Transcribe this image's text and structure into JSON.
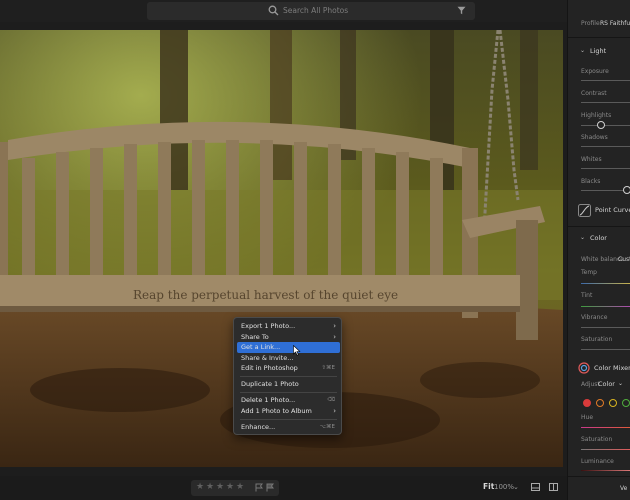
{
  "search": {
    "placeholder": "Search All Photos"
  },
  "photo": {
    "engraving": "Reap the perpetual harvest of the quiet eye"
  },
  "context_menu": {
    "items": [
      {
        "label": "Export 1 Photo...",
        "arrow": "›"
      },
      {
        "label": "Share To",
        "arrow": "›"
      },
      {
        "label": "Get a Link...",
        "highlighted": true
      },
      {
        "label": "Share & Invite..."
      },
      {
        "label": "Edit in Photoshop",
        "shortcut": "⇧⌘E"
      },
      {
        "label": "Duplicate 1 Photo"
      },
      {
        "label": "Delete 1 Photo...",
        "shortcut": "⌫"
      },
      {
        "label": "Add 1 Photo to Album",
        "arrow": "›"
      },
      {
        "label": "Enhance...",
        "shortcut": "⌥⌘E"
      }
    ]
  },
  "bottom_bar": {
    "stars": [
      "★",
      "★",
      "★",
      "★",
      "★"
    ],
    "fit_label": "Fit",
    "zoom_label": "100%",
    "zoom_chevron": "⌄"
  },
  "edit_panel": {
    "profile_label": "Profile",
    "profile_value": "RS Faithful",
    "light_section": "Light",
    "light_sliders": [
      "Exposure",
      "Contrast",
      "Highlights",
      "Shadows",
      "Whites",
      "Blacks"
    ],
    "point_curve": "Point Curve",
    "color_section": "Color",
    "white_balance_label": "White balance",
    "white_balance_value": "Cust",
    "color_sliders": [
      "Temp",
      "Tint",
      "Vibrance",
      "Saturation"
    ],
    "color_mixer": "Color Mixer",
    "adjust_label": "Adjust",
    "adjust_value": "Color",
    "mixer_sliders": [
      "Hue",
      "Saturation",
      "Luminance"
    ],
    "mixer_colors": [
      "#d93b3b",
      "#e07a27",
      "#d6b321",
      "#4fae3c"
    ],
    "bottom_label": "Ve"
  },
  "colors": {
    "accent": "#2f6fd6",
    "background": "#1d1d1d"
  }
}
